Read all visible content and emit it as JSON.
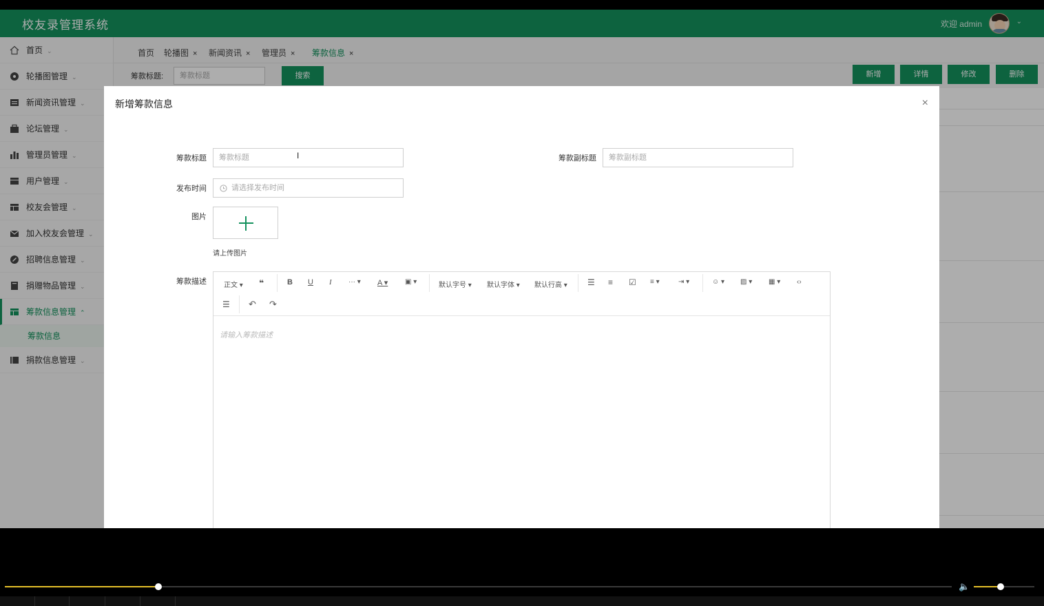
{
  "app": {
    "title": "校友录管理系统",
    "welcome": "欢迎 admin"
  },
  "sidebar": {
    "items": [
      {
        "label": "首页",
        "icon": "home-icon"
      },
      {
        "label": "轮播图管理",
        "icon": "carousel-icon"
      },
      {
        "label": "新闻资讯管理",
        "icon": "news-icon"
      },
      {
        "label": "论坛管理",
        "icon": "forum-icon"
      },
      {
        "label": "管理员管理",
        "icon": "admin-icon"
      },
      {
        "label": "用户管理",
        "icon": "user-icon"
      },
      {
        "label": "校友会管理",
        "icon": "alumni-icon"
      },
      {
        "label": "加入校友会管理",
        "icon": "mail-icon"
      },
      {
        "label": "招聘信息管理",
        "icon": "recruit-icon"
      },
      {
        "label": "捐赠物品管理",
        "icon": "donation-icon"
      },
      {
        "label": "筹款信息管理",
        "icon": "fundraise-icon"
      },
      {
        "label": "捐款信息管理",
        "icon": "donate-money-icon"
      }
    ],
    "sub_item": "筹款信息"
  },
  "tabs": [
    {
      "label": "首页"
    },
    {
      "label": "轮播图"
    },
    {
      "label": "新闻资讯"
    },
    {
      "label": "管理员"
    },
    {
      "label": "筹款信息"
    }
  ],
  "tab_close": "×",
  "search": {
    "label": "筹款标题:",
    "placeholder": "筹款标题",
    "button": "搜索"
  },
  "actions": {
    "add": "新增",
    "detail": "详情",
    "edit": "修改",
    "delete": "删除"
  },
  "modal": {
    "title": "新增筹款信息",
    "close": "×",
    "fields": {
      "title_label": "筹款标题",
      "title_placeholder": "筹款标题",
      "subtitle_label": "筹款副标题",
      "subtitle_placeholder": "筹款副标题",
      "date_label": "发布时间",
      "date_placeholder": "请选择发布时间",
      "image_label": "图片",
      "image_hint": "请上传图片",
      "desc_label": "筹款描述",
      "desc_placeholder": "请输入筹款描述"
    },
    "toolbar": {
      "paragraph": "正文",
      "font_size": "默认字号",
      "font_family": "默认字体",
      "line_height": "默认行高"
    }
  },
  "player": {
    "progress": 0.16,
    "volume": 0.4
  },
  "colors": {
    "brand": "#14925e",
    "progress": "#e6c12a"
  }
}
